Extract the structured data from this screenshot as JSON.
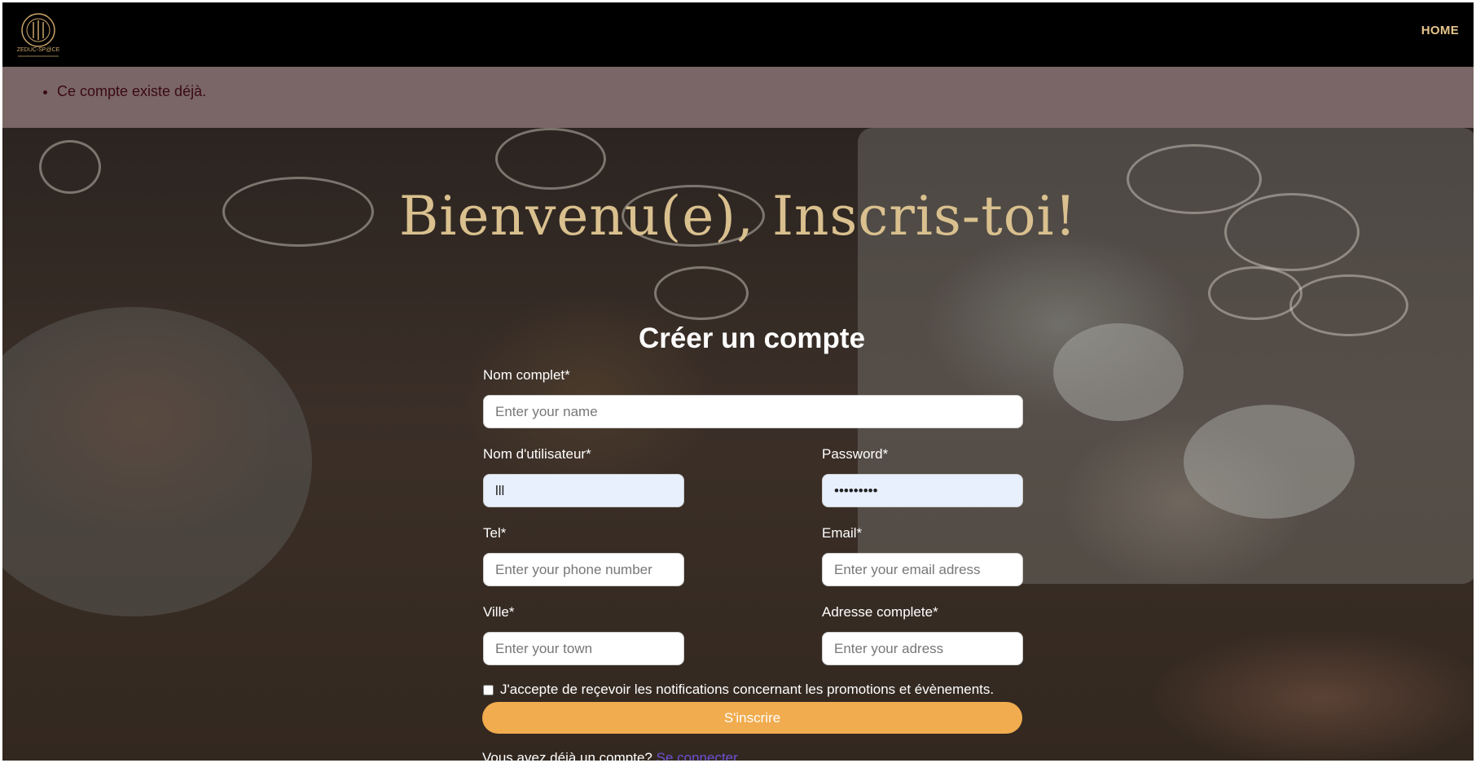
{
  "nav": {
    "home_label": "HOME",
    "logo_text": "ZEDUC-SP@CE"
  },
  "alert": {
    "message": "Ce compte existe déjà."
  },
  "hero": {
    "title": "Bienvenu(e), Inscris-toi!"
  },
  "form": {
    "title": "Créer un compte",
    "full_name": {
      "label": "Nom complet*",
      "placeholder": "Enter your name",
      "value": ""
    },
    "username": {
      "label": "Nom d'utilisateur*",
      "placeholder": "",
      "value": "lll"
    },
    "password": {
      "label": "Password*",
      "placeholder": "",
      "value": "•••••••••"
    },
    "tel": {
      "label": "Tel*",
      "placeholder": "Enter your phone number",
      "value": ""
    },
    "email": {
      "label": "Email*",
      "placeholder": "Enter your email adress",
      "value": ""
    },
    "town": {
      "label": "Ville*",
      "placeholder": "Enter your town",
      "value": ""
    },
    "address": {
      "label": "Adresse complete*",
      "placeholder": "Enter your adress",
      "value": ""
    },
    "notifications_checkbox": {
      "label": "J'accepte de reçevoir les notifications concernant les promotions et évènements.",
      "checked": false
    },
    "submit_label": "S'inscrire",
    "login_prompt": "Vous avez déjà un compte?",
    "login_link": "Se connecter"
  },
  "colors": {
    "accent": "#f0ac4e",
    "hero_title": "#d9c08e",
    "nav_link": "#e7c58d",
    "alert_bg": "#7a6666",
    "link": "#6b52d6"
  }
}
